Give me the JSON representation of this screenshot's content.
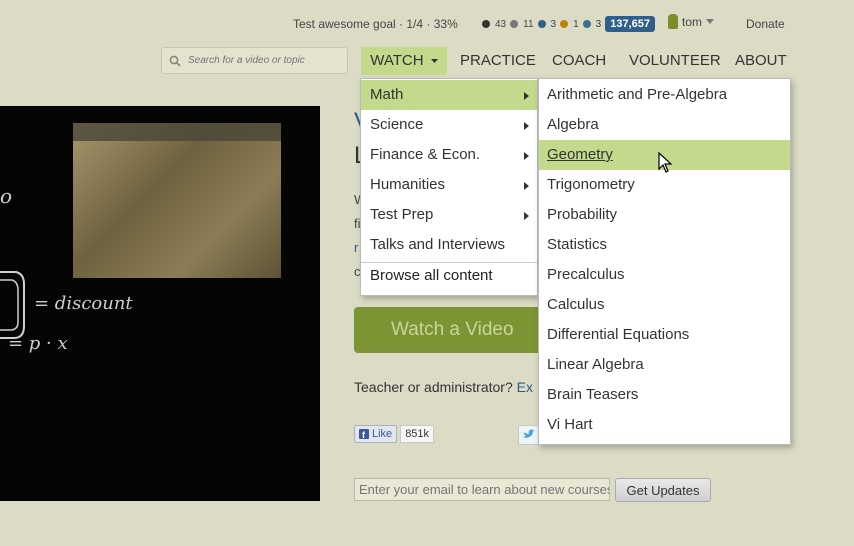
{
  "topbar": {
    "goal": "Test awesome goal · 1/4 · 33%",
    "medals": [
      {
        "count": "43",
        "color": "#333333"
      },
      {
        "count": "11",
        "color": "#777777"
      },
      {
        "count": "3",
        "color": "#2d5f8a"
      },
      {
        "count": "1",
        "color": "#b8860b"
      },
      {
        "count": "3",
        "color": "#3f6f90"
      }
    ],
    "points": "137,657",
    "username": "tom",
    "donate": "Donate"
  },
  "search": {
    "placeholder": "Search for a video or topic"
  },
  "nav": {
    "watch": "WATCH",
    "practice": "PRACTICE",
    "coach": "COACH",
    "volunteer": "VOLUNTEER",
    "about": "ABOUT"
  },
  "video": {
    "chalk1": "= discount",
    "chalk2": "= p · x",
    "chalk3": "o"
  },
  "main": {
    "title1": "V",
    "title2": "L",
    "para": [
      "W",
      "fi",
      "r",
      "c"
    ],
    "watch_button": "Watch a Video",
    "teacher_text": "Teacher or administrator?",
    "teacher_link": "Ex",
    "like_label": "Like",
    "like_count": "851k",
    "email_placeholder": "Enter your email to learn about new courses",
    "get_updates": "Get Updates"
  },
  "menu_watch": {
    "items": [
      "Math",
      "Science",
      "Finance & Econ.",
      "Humanities",
      "Test Prep",
      "Talks and Interviews"
    ],
    "browse_all": "Browse all content"
  },
  "menu_math": {
    "items": [
      "Arithmetic and Pre-Algebra",
      "Algebra",
      "Geometry",
      "Trigonometry",
      "Probability",
      "Statistics",
      "Precalculus",
      "Calculus",
      "Differential Equations",
      "Linear Algebra",
      "Brain Teasers",
      "Vi Hart"
    ]
  },
  "colors": {
    "accent_green": "#c3d98b",
    "watch_button": "#7c9433",
    "link_blue": "#2b5f88",
    "background": "#dcdcc6"
  }
}
